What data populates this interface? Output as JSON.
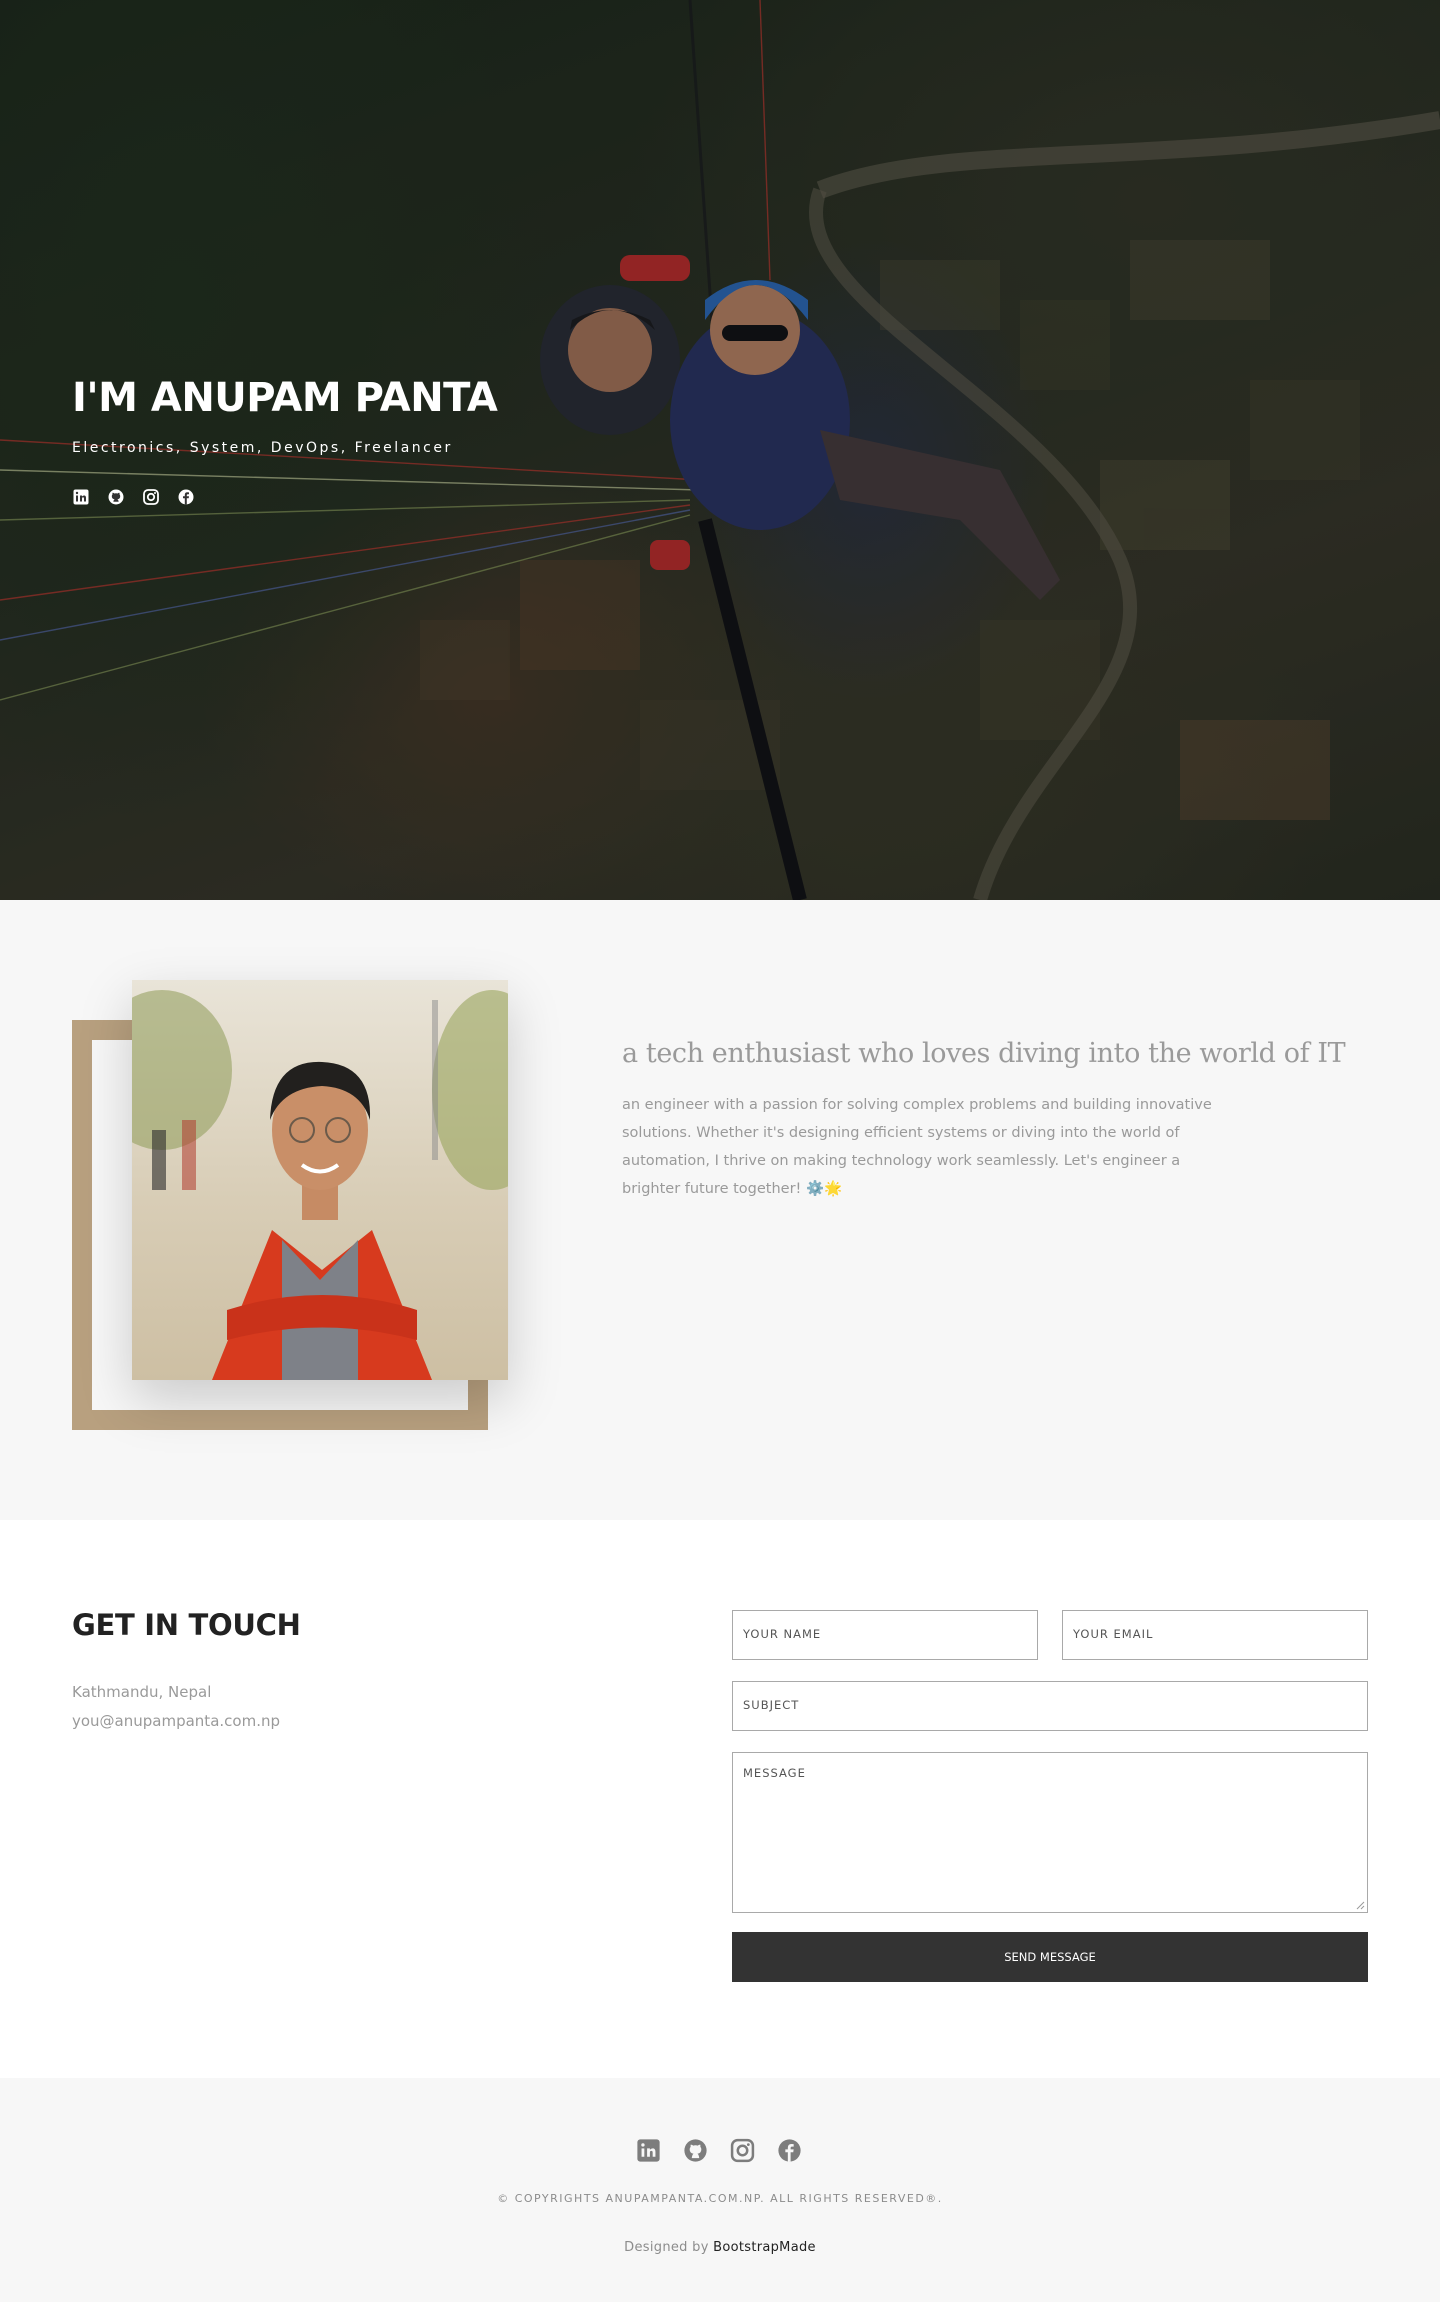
{
  "hero": {
    "title": "I'M ANUPAM PANTA",
    "subtitle": "Electronics, System, DevOps, Freelancer",
    "social": [
      "linkedin-icon",
      "github-icon",
      "instagram-icon",
      "facebook-icon"
    ]
  },
  "about": {
    "heading": "a tech enthusiast who loves diving into the world of IT",
    "body": "an engineer with a passion for solving complex problems and building innovative solutions. Whether it's designing efficient systems or diving into the world of automation, I thrive on making technology work seamlessly. Let's engineer a brighter future together! ⚙️🌟"
  },
  "contact": {
    "title": "GET IN TOUCH",
    "location": "Kathmandu, Nepal",
    "email": "you@anupampanta.com.np",
    "form": {
      "name_placeholder": "YOUR NAME",
      "email_placeholder": "YOUR EMAIL",
      "subject_placeholder": "SUBJECT",
      "message_placeholder": "MESSAGE",
      "submit_label": "SEND MESSAGE"
    }
  },
  "footer": {
    "social": [
      "linkedin-icon",
      "github-icon",
      "instagram-icon",
      "facebook-icon"
    ],
    "copyright": "© COPYRIGHTS ANUPAMPANTA.COM.NP. ALL RIGHTS RESERVED®.",
    "designed_by_prefix": "Designed by",
    "designed_by_link": "BootstrapMade"
  },
  "colors": {
    "frame_accent": "#b8a07f",
    "button_bg": "#333333",
    "section_bg": "#f7f7f7"
  }
}
